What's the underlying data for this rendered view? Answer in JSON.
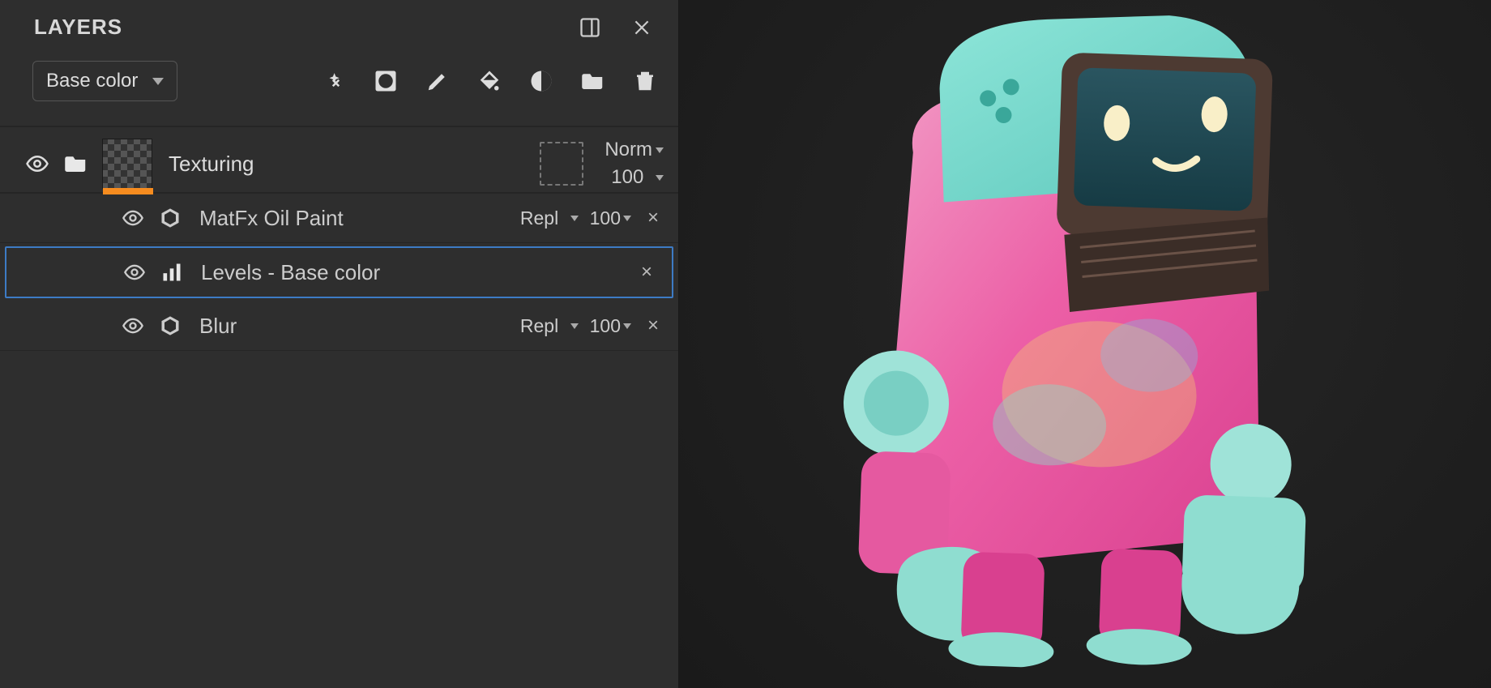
{
  "panel": {
    "title": "LAYERS",
    "channel_dropdown": "Base color"
  },
  "group": {
    "name": "Texturing",
    "blend": "Norm",
    "opacity": "100"
  },
  "sublayers": [
    {
      "name": "MatFx Oil Paint",
      "blend": "Repl",
      "opacity": "100",
      "icon": "sfx",
      "selected": false
    },
    {
      "name": "Levels - Base color",
      "blend": "",
      "opacity": "",
      "icon": "bars",
      "selected": true
    },
    {
      "name": "Blur",
      "blend": "Repl",
      "opacity": "100",
      "icon": "sfx",
      "selected": false
    }
  ]
}
